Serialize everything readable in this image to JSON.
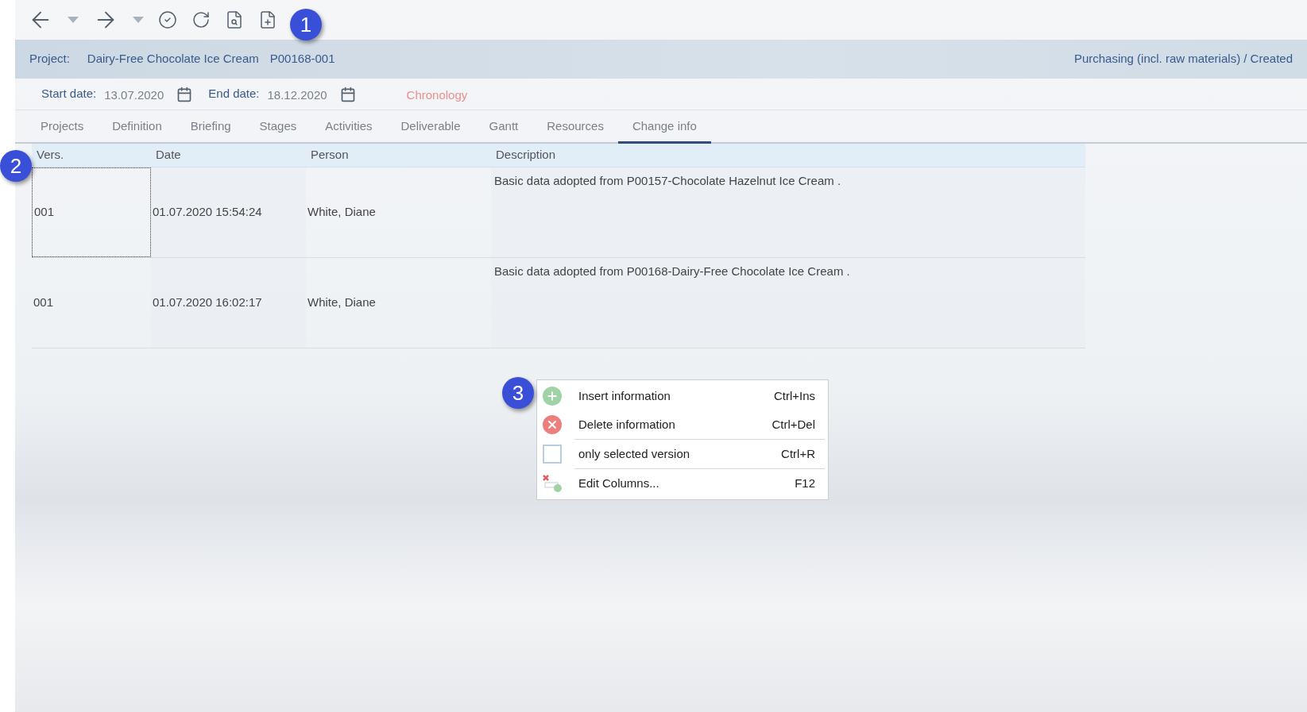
{
  "project": {
    "label": "Project:",
    "name": "Dairy-Free Chocolate Ice Cream",
    "number": "P00168-001",
    "status": "Purchasing (incl. raw materials) / Created"
  },
  "dates": {
    "start_label": "Start date:",
    "start": "13.07.2020",
    "end_label": "End date:",
    "end": "18.12.2020",
    "link": "Chronology"
  },
  "tabs": [
    {
      "label": "Projects",
      "selected": false
    },
    {
      "label": "Definition",
      "selected": false
    },
    {
      "label": "Briefing",
      "selected": false
    },
    {
      "label": "Stages",
      "selected": false
    },
    {
      "label": "Activities",
      "selected": false
    },
    {
      "label": "Deliverable",
      "selected": false
    },
    {
      "label": "Gantt",
      "selected": false
    },
    {
      "label": "Resources",
      "selected": false
    },
    {
      "label": "Change info",
      "selected": true
    }
  ],
  "table": {
    "columns": [
      "Vers.",
      "Date",
      "Person",
      "Description"
    ],
    "rows": [
      {
        "cells": [
          "001",
          "01.07.2020 15:54:24",
          "White, Diane",
          "Basic data adopted from P00157-Chocolate Hazelnut Ice Cream ."
        ],
        "focused": true
      },
      {
        "cells": [
          "001",
          "01.07.2020 16:02:17",
          "White, Diane",
          "Basic data adopted from P00168-Dairy-Free Chocolate Ice Cream ."
        ],
        "focused": false
      }
    ]
  },
  "context_menu": {
    "items": [
      {
        "kind": "add",
        "label": "Insert information",
        "shortcut": "Ctrl+Ins",
        "separator_before": false
      },
      {
        "kind": "delete",
        "label": "Delete information",
        "shortcut": "Ctrl+Del",
        "separator_before": false
      },
      {
        "kind": "checkbox",
        "label": "only selected version",
        "shortcut": "Ctrl+R",
        "checked": false,
        "separator_before": true
      },
      {
        "kind": "columns",
        "label": "Edit Columns...",
        "shortcut": "F12",
        "separator_before": true
      }
    ]
  },
  "callouts": [
    "1",
    "2",
    "3"
  ]
}
